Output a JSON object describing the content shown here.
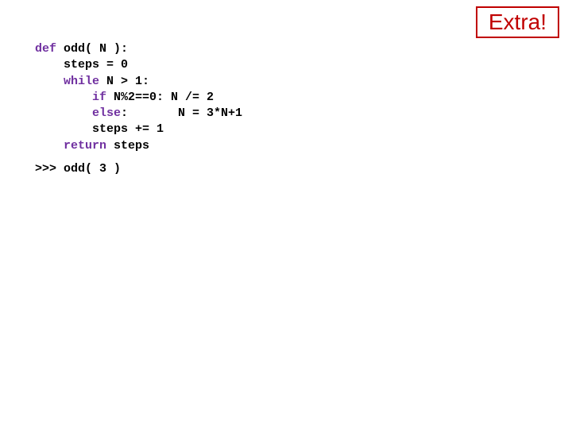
{
  "badge": {
    "text": "Extra!"
  },
  "code": {
    "kw_def": "def",
    "sig": " odd( N ):",
    "l2": "    steps = 0",
    "kw_while": "    while",
    "l3_rest": " N > 1:",
    "kw_if": "        if",
    "l4_rest": " N%2==0: N /= 2",
    "kw_else": "        else",
    "l5_rest": ":       N = 3*N+1",
    "l6": "        steps += 1",
    "kw_return": "    return",
    "l7_rest": " steps"
  },
  "prompt": {
    "text": ">>> odd( 3 )"
  }
}
